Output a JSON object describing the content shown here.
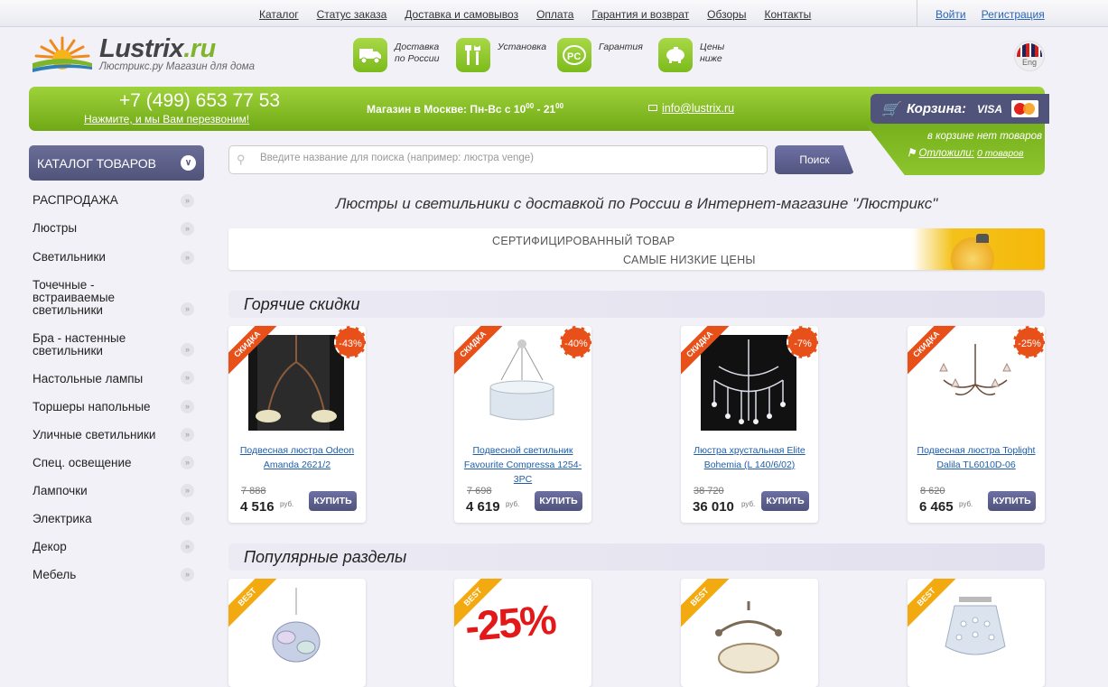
{
  "topnav": {
    "items": [
      "Каталог",
      "Статус заказа",
      "Доставка и самовывоз",
      "Оплата",
      "Гарантия и возврат",
      "Обзоры",
      "Контакты"
    ],
    "login": "Войти",
    "register": "Регистрация"
  },
  "logo": {
    "name_main": "Lustrix",
    "name_suffix": ".ru",
    "tagline": "Люстрикс.ру Магазин для дома"
  },
  "features": [
    {
      "icon": "truck-icon",
      "line1": "Доставка",
      "line2": "по России"
    },
    {
      "icon": "tools-icon",
      "line1": "Установка",
      "line2": ""
    },
    {
      "icon": "guarantee-icon",
      "line1": "Гарантия",
      "line2": ""
    },
    {
      "icon": "piggy-bank-icon",
      "line1": "Цены",
      "line2": "ниже"
    }
  ],
  "lang": {
    "label": "Eng"
  },
  "contact": {
    "phone": "+7 (499) 653 77 53",
    "callback": "Нажмите, и мы Вам перезвоним!",
    "hours_prefix": "Магазин в Москве: Пн-Вс с 10",
    "hours_sup1": "00",
    "hours_mid": " - 21",
    "hours_sup2": "00",
    "email": "info@lustrix.ru"
  },
  "cart": {
    "label": "Корзина:",
    "visa": "VISA",
    "empty": "в корзине нет товаров",
    "deferred_label": "Отложили:",
    "deferred_value": "0 товаров"
  },
  "catalog": {
    "title": "КАТАЛОГ ТОВАРОВ",
    "items": [
      "РАСПРОДАЖА",
      "Люстры",
      "Светильники",
      "Точечные - встраиваемые светильники",
      "Бра - настенные светильники",
      "Настольные лампы",
      "Торшеры напольные",
      "Уличные светильники",
      "Спец. освещение",
      "Лампочки",
      "Электрика",
      "Декор",
      "Мебель"
    ]
  },
  "search": {
    "placeholder": "Введите название для поиска (например: люстра venge)",
    "button": "Поиск"
  },
  "headline": "Люстры и светильники с доставкой по России в Интернет-магазине \"Люстрикс\"",
  "banner": {
    "line1": "СЕРТИФИЦИРОВАННЫЙ  ТОВАР",
    "line2": "САМЫЕ НИЗКИЕ ЦЕНЫ"
  },
  "hot": {
    "title": "Горячие скидки",
    "ribbon": "СКИДКА",
    "currency": "руб.",
    "buy": "КУПИТЬ",
    "products": [
      {
        "discount": "-43%",
        "name": "Подвесная люстра Odeon Amanda 2621/2",
        "old": "7 888",
        "price": "4 516"
      },
      {
        "discount": "-40%",
        "name": "Подвесной светильник Favourite Compressa 1254-3PC",
        "old": "7 698",
        "price": "4 619"
      },
      {
        "discount": "-7%",
        "name": "Люстра хрустальная Elite Bohemia (L 140/6/02)",
        "old": "38 720",
        "price": "36 010"
      },
      {
        "discount": "-25%",
        "name": "Подвесная люстра Toplight Dalila TL6010D-06",
        "old": "8 620",
        "price": "6 465"
      }
    ]
  },
  "popular": {
    "title": "Популярные разделы",
    "ribbon": "BEST",
    "promo": "-25%"
  }
}
